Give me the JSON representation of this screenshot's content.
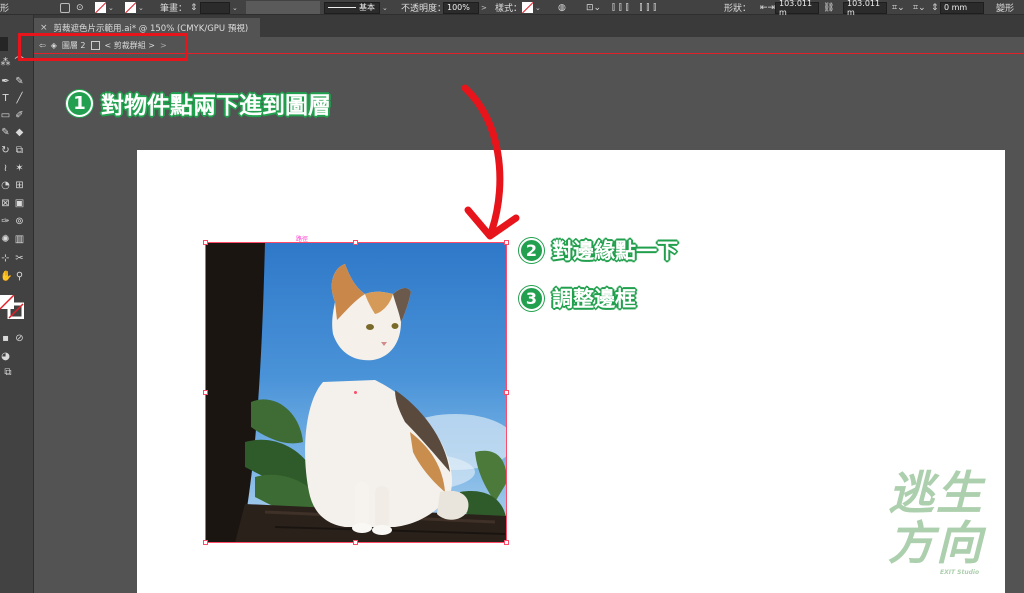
{
  "control_bar": {
    "stroke_label": "筆畫：",
    "stroke_profile": "基本",
    "opacity_label": "不透明度：",
    "opacity_value": "100%",
    "style_label": "樣式：",
    "shape_label": "形狀：",
    "width_value": "103.011 m",
    "height_value": "103.011 m",
    "corner_value": "0 mm",
    "transform_label": "變形",
    "left_cut": "形"
  },
  "tab": {
    "title": "剪裁遮色片示範用.ai* @ 150% (CMYK/GPU 預視)"
  },
  "breadcrumb": {
    "layer": "圖層 2",
    "group": "< 剪裁群組 >"
  },
  "selection": {
    "label": "路徑"
  },
  "annotations": {
    "step1_num": "1",
    "step1_text": "對物件點兩下進到圖層",
    "step2_num": "2",
    "step2_text": "對邊緣點一下",
    "step3_num": "3",
    "step3_text": "調整邊框"
  },
  "watermark": {
    "line1": "逃生",
    "line2": "方向",
    "sub": "EXIT Studio"
  },
  "colors": {
    "highlight": "#e8141b",
    "step_green": "#23a04f",
    "selection": "#ff4a6a",
    "ui_dark": "#424242",
    "ui_mid": "#535353"
  }
}
